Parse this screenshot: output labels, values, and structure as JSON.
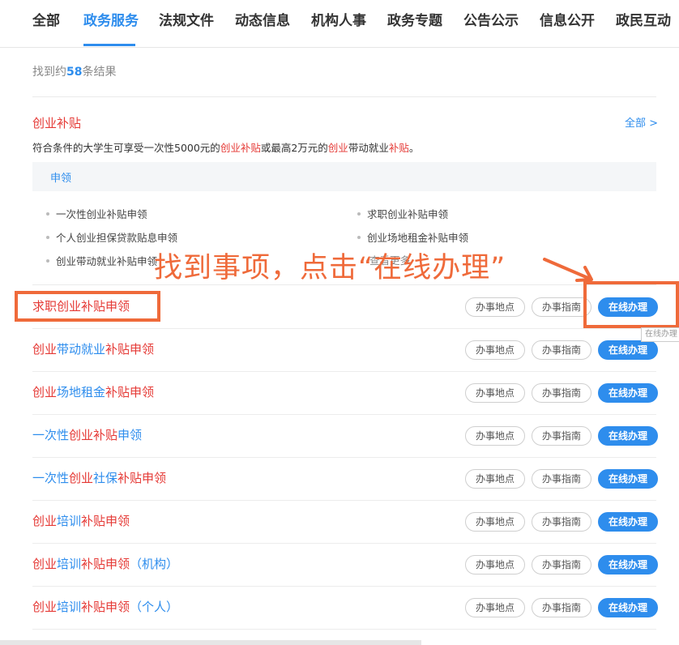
{
  "nav": {
    "tabs": [
      {
        "label": "全部"
      },
      {
        "label": "政务服务"
      },
      {
        "label": "法规文件"
      },
      {
        "label": "动态信息"
      },
      {
        "label": "机构人事"
      },
      {
        "label": "政务专题"
      },
      {
        "label": "公告公示"
      },
      {
        "label": "信息公开"
      },
      {
        "label": "政民互动"
      }
    ],
    "active": "政务服务"
  },
  "result": {
    "prefix": "找到约",
    "count": "58",
    "suffix": "条结果"
  },
  "service": {
    "title": "创业补贴",
    "all_link": "全部 >",
    "desc": {
      "p1": "符合条件的大学生可享受一次性5000元的",
      "h1": "创业补贴",
      "p2": "或最高2万元的",
      "h2": "创业",
      "p3": "带动就业",
      "h3": "补贴",
      "p4": "。"
    },
    "apply_label": "申领",
    "sub_items": [
      "一次性创业补贴申领",
      "求职创业补贴申领",
      "个人创业担保贷款贴息申领",
      "创业场地租金补贴申领",
      "创业带动就业补贴申领"
    ],
    "view_more": "查看更多"
  },
  "rows": [
    {
      "segments": [
        {
          "t": "求职创业补贴申领",
          "c": "r"
        }
      ]
    },
    {
      "segments": [
        {
          "t": "创业",
          "c": "r"
        },
        {
          "t": "带动就业",
          "c": "b"
        },
        {
          "t": "补贴申领",
          "c": "r"
        }
      ]
    },
    {
      "segments": [
        {
          "t": "创业",
          "c": "r"
        },
        {
          "t": "场地租金",
          "c": "b"
        },
        {
          "t": "补贴申领",
          "c": "r"
        }
      ]
    },
    {
      "segments": [
        {
          "t": "一次性",
          "c": "b"
        },
        {
          "t": "创业补贴",
          "c": "r"
        },
        {
          "t": "申领",
          "c": "b"
        }
      ]
    },
    {
      "segments": [
        {
          "t": "一次性",
          "c": "b"
        },
        {
          "t": "创业",
          "c": "r"
        },
        {
          "t": "社保",
          "c": "b"
        },
        {
          "t": "补贴申领",
          "c": "r"
        }
      ]
    },
    {
      "segments": [
        {
          "t": "创业",
          "c": "r"
        },
        {
          "t": "培训",
          "c": "b"
        },
        {
          "t": "补贴申领",
          "c": "r"
        }
      ]
    },
    {
      "segments": [
        {
          "t": "创业",
          "c": "r"
        },
        {
          "t": "培训",
          "c": "b"
        },
        {
          "t": "补贴申领",
          "c": "r"
        },
        {
          "t": "（机构）",
          "c": "b"
        }
      ]
    },
    {
      "segments": [
        {
          "t": "创业",
          "c": "r"
        },
        {
          "t": "培训",
          "c": "b"
        },
        {
          "t": "补贴申领",
          "c": "r"
        },
        {
          "t": "（个人）",
          "c": "b"
        }
      ]
    }
  ],
  "buttons": {
    "location": "办事地点",
    "guide": "办事指南",
    "online": "在线办理"
  },
  "annotation": {
    "text": "找到事项，点击“在线办理”"
  },
  "tooltip": "在线办理",
  "colors": {
    "accent": "#2e8ded",
    "highlight": "#e53935",
    "annotation": "#ef6a3a"
  }
}
